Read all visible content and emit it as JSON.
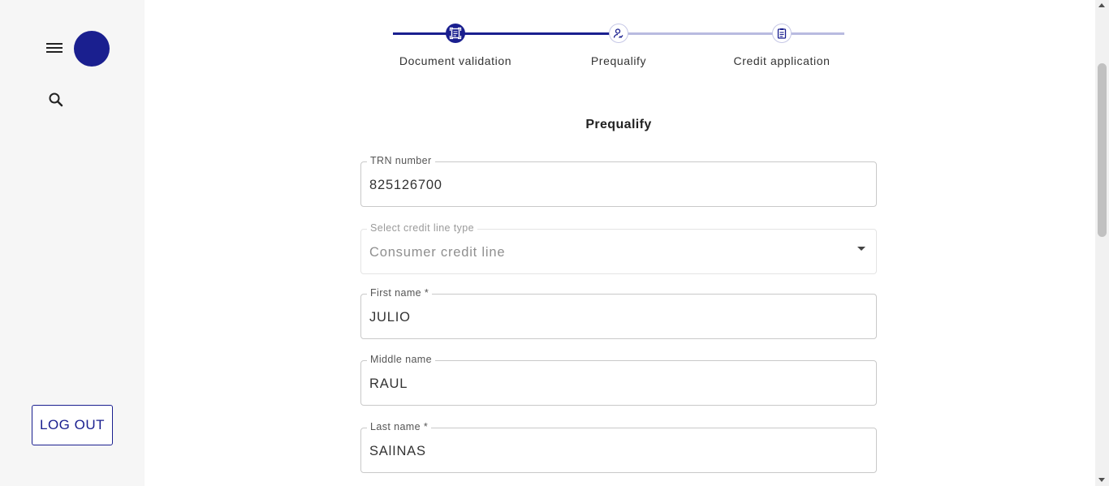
{
  "sidebar": {
    "logout_label": "LOG OUT"
  },
  "stepper": {
    "steps": [
      {
        "label": "Document validation",
        "status": "active",
        "icon": "document-scan-icon"
      },
      {
        "label": "Prequalify",
        "status": "pending",
        "icon": "signature-icon"
      },
      {
        "label": "Credit application",
        "status": "pending",
        "icon": "clipboard-icon"
      }
    ]
  },
  "form": {
    "title": "Prequalify",
    "trn": {
      "label": "TRN number",
      "value": "825126700"
    },
    "credit_line": {
      "label": "Select credit line type",
      "value": "Consumer credit line"
    },
    "first_name": {
      "label": "First name *",
      "value": "JULIO"
    },
    "middle_name": {
      "label": "Middle name",
      "value": "RAUL"
    },
    "last_name": {
      "label": "Last name *",
      "value": "SAlINAS"
    }
  },
  "colors": {
    "primary": "#1a1f8f",
    "pending": "#b9bbe0",
    "sidebar_bg": "#f6f6f6"
  }
}
